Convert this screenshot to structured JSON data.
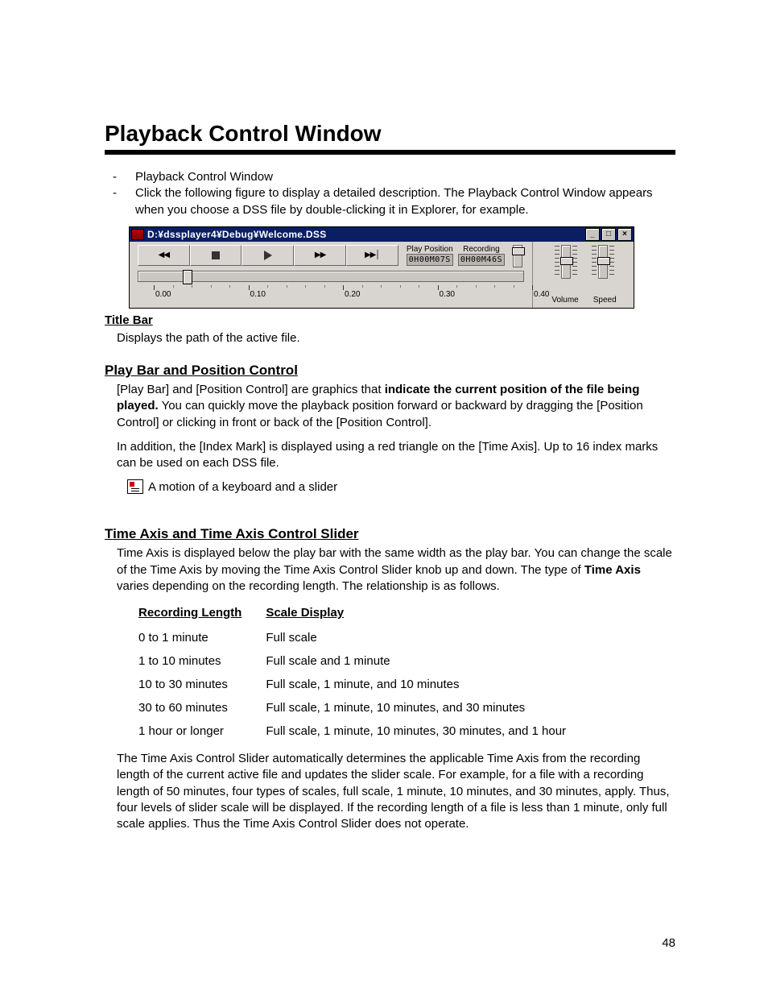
{
  "heading": "Playback Control Window",
  "bullets": [
    "Playback Control Window",
    "Click the following figure to display a detailed description.  The Playback Control Window appears when you choose a DSS file by double-clicking it in Explorer, for example."
  ],
  "player": {
    "title": "D:¥dssplayer4¥Debug¥Welcome.DSS",
    "minimize": "_",
    "maximize": "□",
    "close": "×",
    "play_position_label": "Play Position",
    "recording_label": "Recording",
    "play_position_value": "0H00M07S",
    "recording_value": "0H00M46S",
    "ticks": [
      "0.00",
      "0.10",
      "0.20",
      "0.30",
      "0.40"
    ],
    "volume_label": "Volume",
    "speed_label": "Speed"
  },
  "title_bar": {
    "head": "Title Bar",
    "text": "Displays the path of the active file."
  },
  "play_bar": {
    "head": "Play Bar and Position Control",
    "p1_a": " [Play Bar] and [Position Control] are graphics that ",
    "p1_b": "indicate the current position of the file being played.",
    "p1_c": "  You can quickly move the playback position forward or backward by dragging the [Position Control] or clicking in front or back of the [Position Control].",
    "p2": "In addition, the [Index Mark] is displayed using a red triangle on the [Time Axis].  Up to 16 index marks can be used on each DSS file.",
    "note": "A motion of a keyboard and a slider"
  },
  "time_axis": {
    "head": "Time Axis and Time Axis Control Slider",
    "p1_a": "Time Axis is displayed below the play bar with the same width as the play bar.  You can change the scale of the Time Axis by moving the Time Axis Control Slider knob up and down.  The type of ",
    "p1_b": "Time Axis",
    "p1_c": " varies depending on the recording length.  The relationship is as follows.",
    "col1": "Recording Length",
    "col2": "Scale Display",
    "rows": [
      [
        "0 to 1 minute",
        "Full scale"
      ],
      [
        "1 to 10 minutes",
        "Full scale and 1 minute"
      ],
      [
        "10 to 30 minutes",
        "Full scale, 1 minute, and 10 minutes"
      ],
      [
        "30 to 60 minutes",
        "Full scale, 1 minute, 10 minutes, and 30 minutes"
      ],
      [
        "1 hour or longer",
        "Full scale, 1 minute, 10 minutes, 30 minutes, and 1 hour"
      ]
    ],
    "p2": "The Time Axis Control Slider automatically determines the applicable Time Axis from the recording length of the current active file and updates the slider scale.  For example, for a file with a recording length of 50 minutes, four types of scales, full scale, 1 minute, 10 minutes, and 30 minutes, apply.  Thus, four levels of slider scale will be displayed.  If the recording length of a file is less than 1 minute, only full scale applies.  Thus the Time Axis Control Slider does not operate."
  },
  "page_number": "48"
}
